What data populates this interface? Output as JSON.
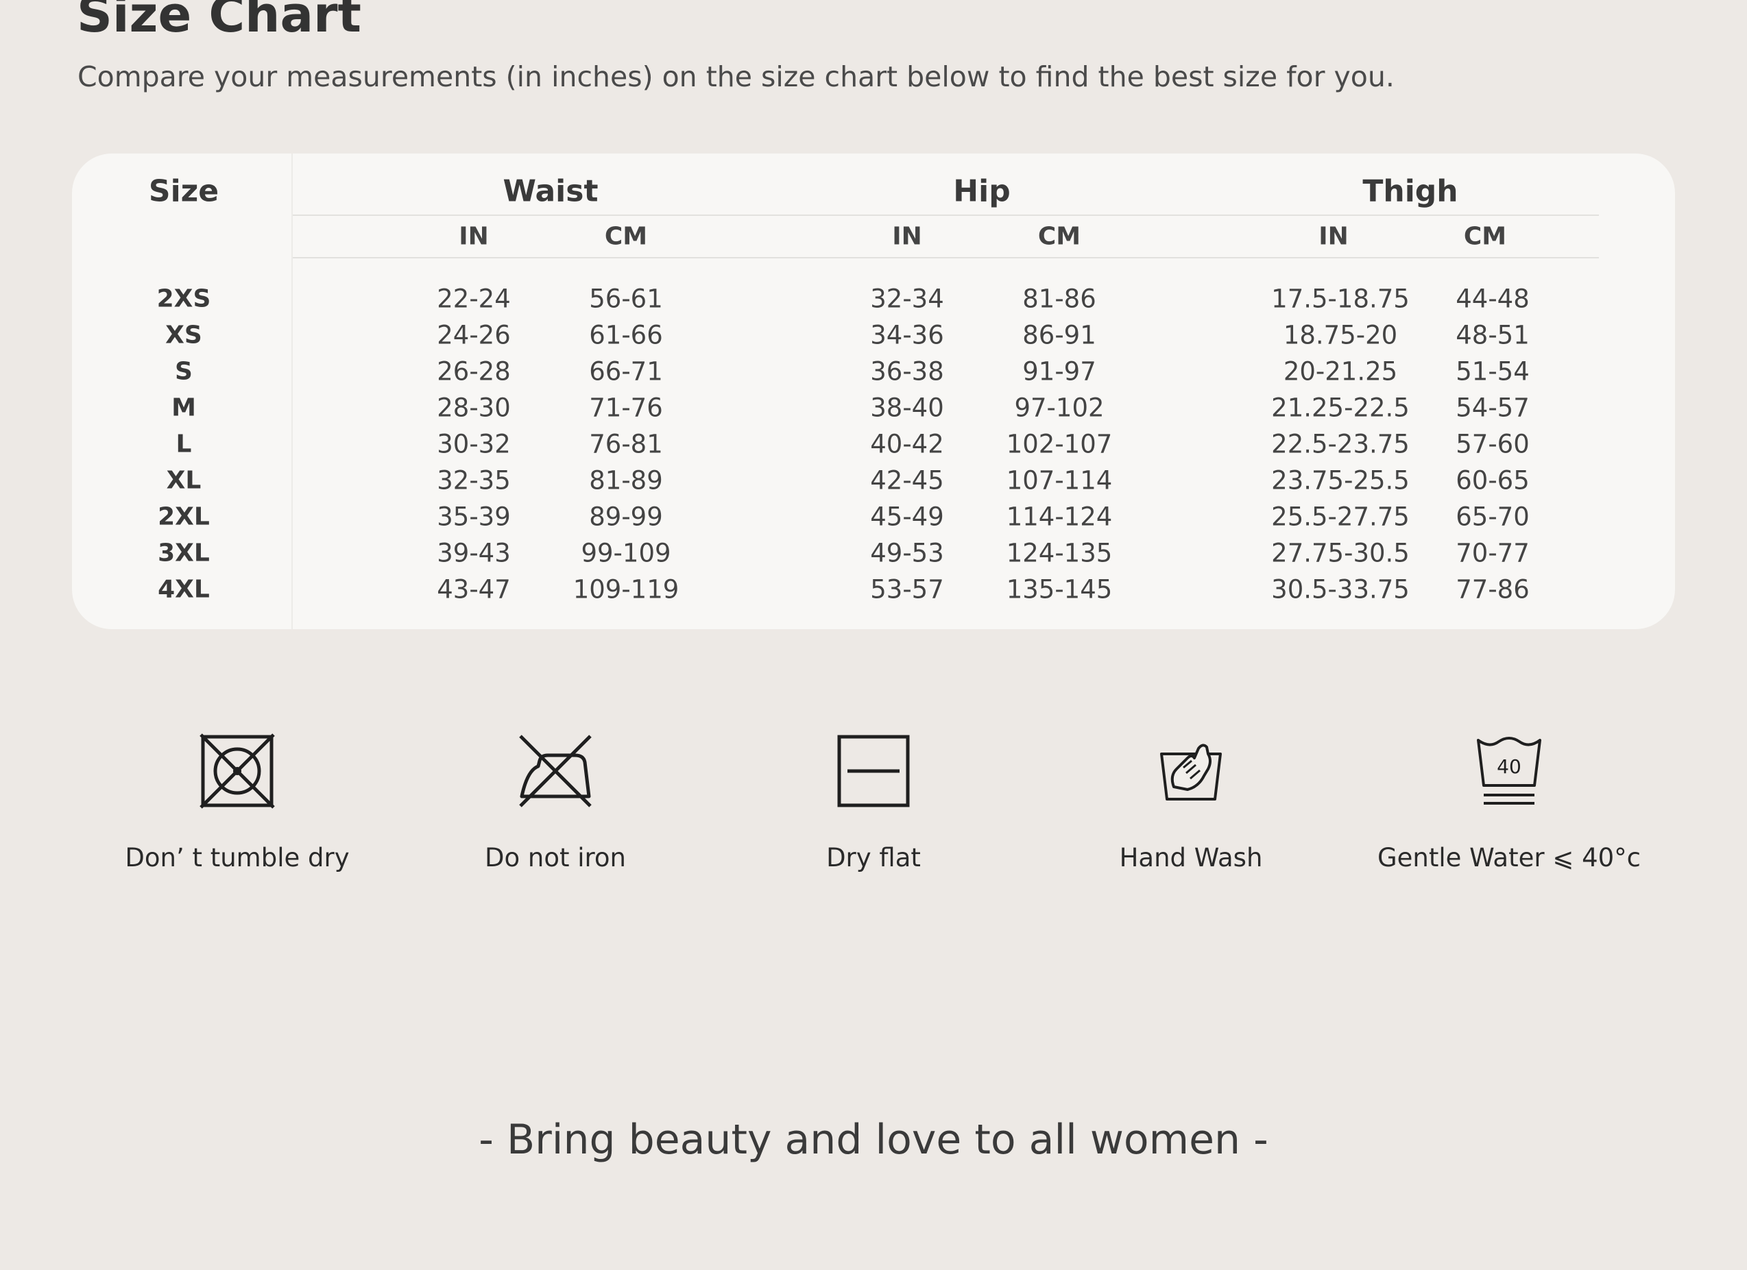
{
  "header": {
    "title": "Size Chart",
    "subtitle": "Compare your measurements (in inches) on the size chart below to find the best size for you."
  },
  "table": {
    "size_header": "Size",
    "groups": [
      {
        "name": "Waist",
        "units": [
          "IN",
          "CM"
        ]
      },
      {
        "name": "Hip",
        "units": [
          "IN",
          "CM"
        ]
      },
      {
        "name": "Thigh",
        "units": [
          "IN",
          "CM"
        ]
      }
    ],
    "rows": [
      {
        "size": "2XS",
        "values": [
          "22-24",
          "56-61",
          "32-34",
          "81-86",
          "17.5-18.75",
          "44-48"
        ]
      },
      {
        "size": "XS",
        "values": [
          "24-26",
          "61-66",
          "34-36",
          "86-91",
          "18.75-20",
          "48-51"
        ]
      },
      {
        "size": "S",
        "values": [
          "26-28",
          "66-71",
          "36-38",
          "91-97",
          "20-21.25",
          "51-54"
        ]
      },
      {
        "size": "M",
        "values": [
          "28-30",
          "71-76",
          "38-40",
          "97-102",
          "21.25-22.5",
          "54-57"
        ]
      },
      {
        "size": "L",
        "values": [
          "30-32",
          "76-81",
          "40-42",
          "102-107",
          "22.5-23.75",
          "57-60"
        ]
      },
      {
        "size": "XL",
        "values": [
          "32-35",
          "81-89",
          "42-45",
          "107-114",
          "23.75-25.5",
          "60-65"
        ]
      },
      {
        "size": "2XL",
        "values": [
          "35-39",
          "89-99",
          "45-49",
          "114-124",
          "25.5-27.75",
          "65-70"
        ]
      },
      {
        "size": "3XL",
        "values": [
          "39-43",
          "99-109",
          "49-53",
          "124-135",
          "27.75-30.5",
          "70-77"
        ]
      },
      {
        "size": "4XL",
        "values": [
          "43-47",
          "109-119",
          "53-57",
          "135-145",
          "30.5-33.75",
          "77-86"
        ]
      }
    ]
  },
  "care": [
    {
      "label": "Don’ t tumble dry",
      "icon": "no-tumble-dry-icon"
    },
    {
      "label": "Do not iron",
      "icon": "no-iron-icon"
    },
    {
      "label": "Dry flat",
      "icon": "dry-flat-icon"
    },
    {
      "label": "Hand Wash",
      "icon": "hand-wash-icon"
    },
    {
      "label": "Gentle Water ⩽ 40°c",
      "icon": "wash-40-icon",
      "icon_text": "40"
    }
  ],
  "tagline": "- Bring beauty and love to all women -"
}
